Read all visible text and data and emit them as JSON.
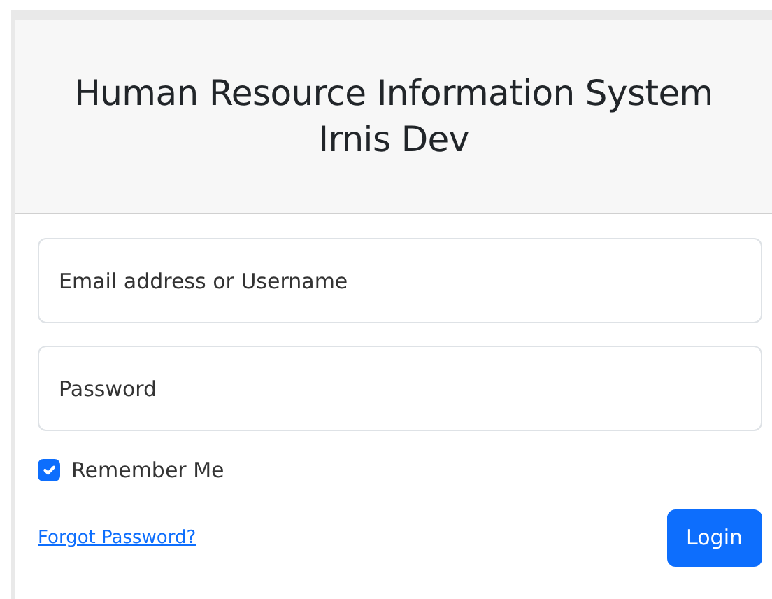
{
  "header": {
    "title_lines": [
      "Human Resource Information System",
      "Irnis Dev"
    ]
  },
  "fields": [
    {
      "placeholder": "Email address or Username"
    },
    {
      "placeholder": "Password"
    }
  ],
  "remember": {
    "label": "Remember Me",
    "checked": true
  },
  "forgot_link": "Forgot Password?",
  "login_button": "Login"
}
